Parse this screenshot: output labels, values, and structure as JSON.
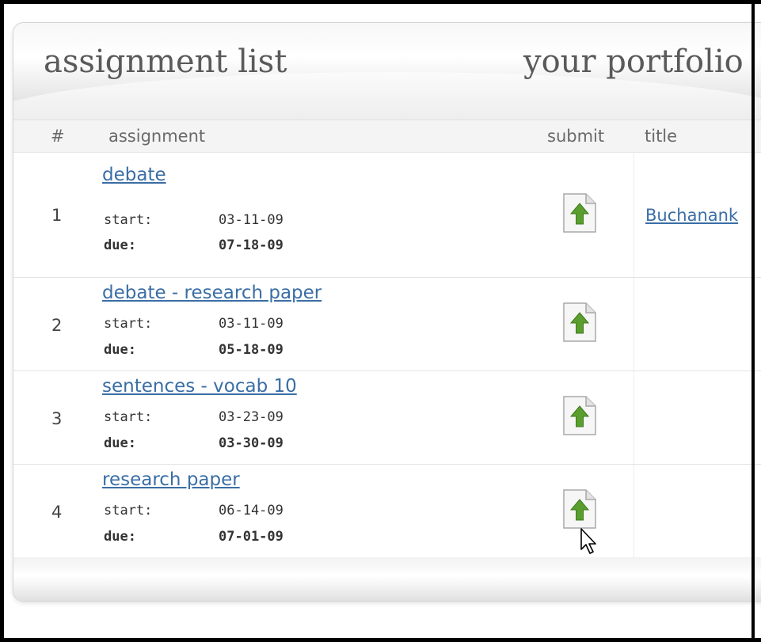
{
  "header": {
    "left_title": "assignment list",
    "right_title": "your portfolio"
  },
  "columns": {
    "num": "#",
    "assignment": "assignment",
    "submit": "submit",
    "title": "title"
  },
  "labels": {
    "start": "start:",
    "due": "due:"
  },
  "rows": [
    {
      "num": "1",
      "name": "debate",
      "start": "03-11-09",
      "due": "07-18-09",
      "title": "Buchanank"
    },
    {
      "num": "2",
      "name": "debate - research paper",
      "start": "03-11-09",
      "due": "05-18-09",
      "title": ""
    },
    {
      "num": "3",
      "name": "sentences - vocab 10",
      "start": "03-23-09",
      "due": "03-30-09",
      "title": ""
    },
    {
      "num": "4",
      "name": "research paper",
      "start": "06-14-09",
      "due": "07-01-09",
      "title": ""
    }
  ],
  "icons": {
    "submit": "upload-document-icon",
    "cursor": "mouse-pointer-icon"
  },
  "colors": {
    "link": "#3a6ea5",
    "arrow": "#5a9e2f",
    "header_text": "#5a5a5a"
  }
}
